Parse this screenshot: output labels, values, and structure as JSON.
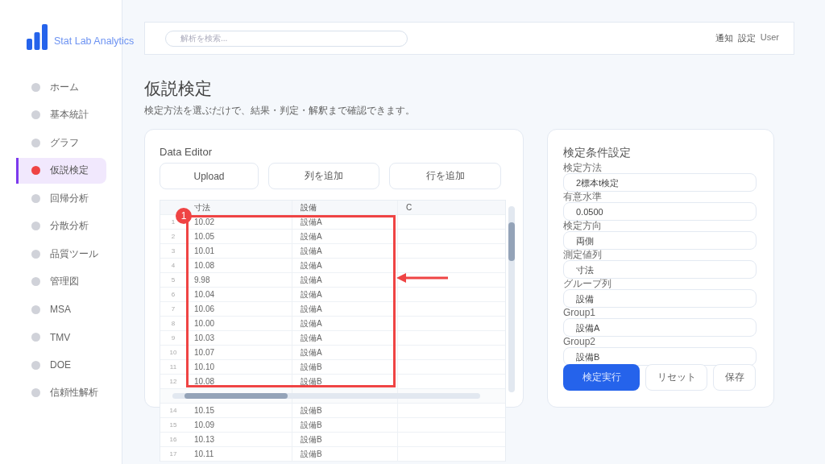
{
  "sidebar": {
    "brand": "Stat Lab Analytics",
    "items": [
      {
        "label": "ホーム",
        "selected": false
      },
      {
        "label": "基本統計",
        "selected": false
      },
      {
        "label": "グラフ",
        "selected": false
      },
      {
        "label": "仮説検定",
        "selected": true
      },
      {
        "label": "回帰分析",
        "selected": false
      },
      {
        "label": "分散分析",
        "selected": false
      },
      {
        "label": "品質ツール",
        "selected": false
      },
      {
        "label": "管理図",
        "selected": false
      },
      {
        "label": "MSA",
        "selected": false
      },
      {
        "label": "TMV",
        "selected": false
      },
      {
        "label": "DOE",
        "selected": false
      },
      {
        "label": "信頼性解析",
        "selected": false
      }
    ]
  },
  "topbar": {
    "search": {
      "placeholder": "解析を検索..."
    },
    "links": [
      "通知",
      "設定",
      "User"
    ]
  },
  "page": {
    "title": "仮説検定",
    "subtitle": "検定方法を選ぶだけで、結果・判定・解釈まで確認できます。"
  },
  "data_editor": {
    "title": "Data Editor",
    "buttons": [
      "Upload",
      "列を追加",
      "行を追加"
    ],
    "table": {
      "columns": [
        "寸法",
        "設備",
        "C"
      ],
      "rows": [
        {
          "number": "1",
          "cells": [
            "10.02",
            "設備A"
          ]
        },
        {
          "number": "2",
          "cells": [
            "10.05",
            "設備A"
          ]
        },
        {
          "number": "3",
          "cells": [
            "10.01",
            "設備A"
          ]
        },
        {
          "number": "4",
          "cells": [
            "10.08",
            "設備A"
          ]
        },
        {
          "number": "5",
          "cells": [
            "9.98",
            "設備A"
          ]
        },
        {
          "number": "6",
          "cells": [
            "10.04",
            "設備A"
          ]
        },
        {
          "number": "7",
          "cells": [
            "10.06",
            "設備A"
          ]
        },
        {
          "number": "8",
          "cells": [
            "10.00",
            "設備A"
          ]
        },
        {
          "number": "9",
          "cells": [
            "10.03",
            "設備A"
          ]
        },
        {
          "number": "10",
          "cells": [
            "10.07",
            "設備A"
          ]
        },
        {
          "number": "11",
          "cells": [
            "10.10",
            "設備B"
          ]
        },
        {
          "number": "12",
          "cells": [
            "10.08",
            "設備B"
          ]
        },
        {
          "covered": true
        },
        {
          "number": "14",
          "cells": [
            "10.15",
            "設備B"
          ]
        },
        {
          "number": "15",
          "cells": [
            "10.09",
            "設備B"
          ]
        },
        {
          "number": "16",
          "cells": [
            "10.13",
            "設備B"
          ]
        },
        {
          "number": "17",
          "cells": [
            "10.11",
            "設備B"
          ]
        }
      ]
    },
    "annotation": {
      "number": "1"
    }
  },
  "settings": {
    "title": "検定条件設定",
    "fields": [
      {
        "label": "検定方法",
        "value": "2標本t検定"
      },
      {
        "label": "有意水準",
        "value": "0.0500"
      },
      {
        "label": "検定方向",
        "value": "両側"
      },
      {
        "label": "測定値列",
        "value": "寸法"
      },
      {
        "label": "グループ列",
        "value": "設備"
      },
      {
        "label": "Group1",
        "value": "設備A"
      },
      {
        "label": "Group2",
        "value": "設備B"
      }
    ],
    "buttons": [
      {
        "label": "検定実行",
        "kind": "primary"
      },
      {
        "label": "リセット",
        "kind": "secondary"
      },
      {
        "label": "保存",
        "kind": "secondary"
      }
    ]
  }
}
